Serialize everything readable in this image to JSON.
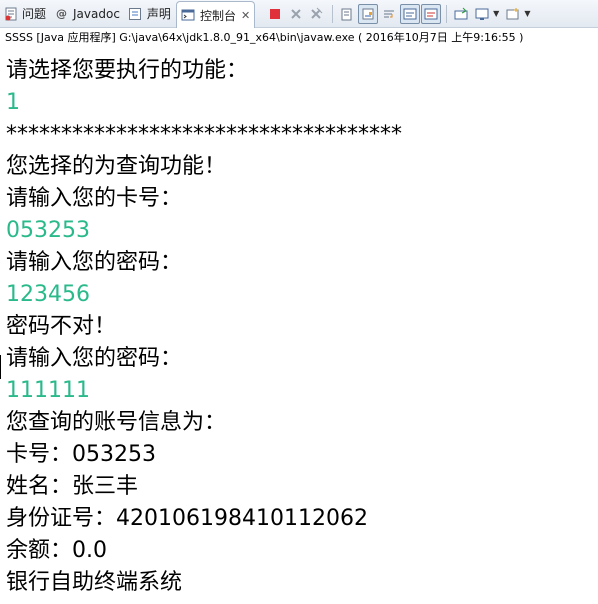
{
  "tabs": [
    {
      "label": "问题",
      "icon": "problems-icon"
    },
    {
      "label": "Javadoc",
      "icon": "at-icon"
    },
    {
      "label": "声明",
      "icon": "declaration-icon"
    },
    {
      "label": "控制台",
      "icon": "console-icon",
      "active": true
    }
  ],
  "process": "SSSS [Java 应用程序] G:\\java\\64x\\jdk1.8.0_91_x64\\bin\\javaw.exe ( 2016年10月7日 上午9:16:55 )",
  "colors": {
    "input": "#2ab98b",
    "output": "#000000",
    "terminate": "#e0303a"
  },
  "console_lines": [
    {
      "text": "请选择您要执行的功能：",
      "kind": "output"
    },
    {
      "text": "1",
      "kind": "input"
    },
    {
      "text": "************************************",
      "kind": "output"
    },
    {
      "text": "您选择的为查询功能！",
      "kind": "output"
    },
    {
      "text": "请输入您的卡号：",
      "kind": "output"
    },
    {
      "text": "053253",
      "kind": "input"
    },
    {
      "text": "请输入您的密码：",
      "kind": "output"
    },
    {
      "text": "123456",
      "kind": "input"
    },
    {
      "text": "密码不对！",
      "kind": "output"
    },
    {
      "text": "请输入您的密码：",
      "kind": "output"
    },
    {
      "text": "111111",
      "kind": "input"
    },
    {
      "text": "您查询的账号信息为：",
      "kind": "output"
    },
    {
      "text": "卡号：053253",
      "kind": "output"
    },
    {
      "text": "姓名：张三丰",
      "kind": "output"
    },
    {
      "text": "身份证号：420106198410112062",
      "kind": "output"
    },
    {
      "text": "余额：0.0",
      "kind": "output"
    },
    {
      "text": "银行自助终端系统",
      "kind": "output"
    }
  ]
}
